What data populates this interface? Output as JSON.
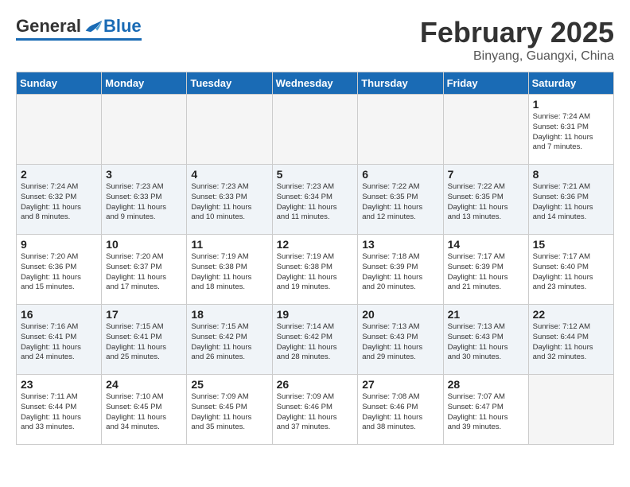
{
  "logo": {
    "general": "General",
    "blue": "Blue"
  },
  "title": "February 2025",
  "location": "Binyang, Guangxi, China",
  "days_of_week": [
    "Sunday",
    "Monday",
    "Tuesday",
    "Wednesday",
    "Thursday",
    "Friday",
    "Saturday"
  ],
  "weeks": [
    [
      {
        "day": "",
        "info": ""
      },
      {
        "day": "",
        "info": ""
      },
      {
        "day": "",
        "info": ""
      },
      {
        "day": "",
        "info": ""
      },
      {
        "day": "",
        "info": ""
      },
      {
        "day": "",
        "info": ""
      },
      {
        "day": "1",
        "info": "Sunrise: 7:24 AM\nSunset: 6:31 PM\nDaylight: 11 hours\nand 7 minutes."
      }
    ],
    [
      {
        "day": "2",
        "info": "Sunrise: 7:24 AM\nSunset: 6:32 PM\nDaylight: 11 hours\nand 8 minutes."
      },
      {
        "day": "3",
        "info": "Sunrise: 7:23 AM\nSunset: 6:33 PM\nDaylight: 11 hours\nand 9 minutes."
      },
      {
        "day": "4",
        "info": "Sunrise: 7:23 AM\nSunset: 6:33 PM\nDaylight: 11 hours\nand 10 minutes."
      },
      {
        "day": "5",
        "info": "Sunrise: 7:23 AM\nSunset: 6:34 PM\nDaylight: 11 hours\nand 11 minutes."
      },
      {
        "day": "6",
        "info": "Sunrise: 7:22 AM\nSunset: 6:35 PM\nDaylight: 11 hours\nand 12 minutes."
      },
      {
        "day": "7",
        "info": "Sunrise: 7:22 AM\nSunset: 6:35 PM\nDaylight: 11 hours\nand 13 minutes."
      },
      {
        "day": "8",
        "info": "Sunrise: 7:21 AM\nSunset: 6:36 PM\nDaylight: 11 hours\nand 14 minutes."
      }
    ],
    [
      {
        "day": "9",
        "info": "Sunrise: 7:20 AM\nSunset: 6:36 PM\nDaylight: 11 hours\nand 15 minutes."
      },
      {
        "day": "10",
        "info": "Sunrise: 7:20 AM\nSunset: 6:37 PM\nDaylight: 11 hours\nand 17 minutes."
      },
      {
        "day": "11",
        "info": "Sunrise: 7:19 AM\nSunset: 6:38 PM\nDaylight: 11 hours\nand 18 minutes."
      },
      {
        "day": "12",
        "info": "Sunrise: 7:19 AM\nSunset: 6:38 PM\nDaylight: 11 hours\nand 19 minutes."
      },
      {
        "day": "13",
        "info": "Sunrise: 7:18 AM\nSunset: 6:39 PM\nDaylight: 11 hours\nand 20 minutes."
      },
      {
        "day": "14",
        "info": "Sunrise: 7:17 AM\nSunset: 6:39 PM\nDaylight: 11 hours\nand 21 minutes."
      },
      {
        "day": "15",
        "info": "Sunrise: 7:17 AM\nSunset: 6:40 PM\nDaylight: 11 hours\nand 23 minutes."
      }
    ],
    [
      {
        "day": "16",
        "info": "Sunrise: 7:16 AM\nSunset: 6:41 PM\nDaylight: 11 hours\nand 24 minutes."
      },
      {
        "day": "17",
        "info": "Sunrise: 7:15 AM\nSunset: 6:41 PM\nDaylight: 11 hours\nand 25 minutes."
      },
      {
        "day": "18",
        "info": "Sunrise: 7:15 AM\nSunset: 6:42 PM\nDaylight: 11 hours\nand 26 minutes."
      },
      {
        "day": "19",
        "info": "Sunrise: 7:14 AM\nSunset: 6:42 PM\nDaylight: 11 hours\nand 28 minutes."
      },
      {
        "day": "20",
        "info": "Sunrise: 7:13 AM\nSunset: 6:43 PM\nDaylight: 11 hours\nand 29 minutes."
      },
      {
        "day": "21",
        "info": "Sunrise: 7:13 AM\nSunset: 6:43 PM\nDaylight: 11 hours\nand 30 minutes."
      },
      {
        "day": "22",
        "info": "Sunrise: 7:12 AM\nSunset: 6:44 PM\nDaylight: 11 hours\nand 32 minutes."
      }
    ],
    [
      {
        "day": "23",
        "info": "Sunrise: 7:11 AM\nSunset: 6:44 PM\nDaylight: 11 hours\nand 33 minutes."
      },
      {
        "day": "24",
        "info": "Sunrise: 7:10 AM\nSunset: 6:45 PM\nDaylight: 11 hours\nand 34 minutes."
      },
      {
        "day": "25",
        "info": "Sunrise: 7:09 AM\nSunset: 6:45 PM\nDaylight: 11 hours\nand 35 minutes."
      },
      {
        "day": "26",
        "info": "Sunrise: 7:09 AM\nSunset: 6:46 PM\nDaylight: 11 hours\nand 37 minutes."
      },
      {
        "day": "27",
        "info": "Sunrise: 7:08 AM\nSunset: 6:46 PM\nDaylight: 11 hours\nand 38 minutes."
      },
      {
        "day": "28",
        "info": "Sunrise: 7:07 AM\nSunset: 6:47 PM\nDaylight: 11 hours\nand 39 minutes."
      },
      {
        "day": "",
        "info": ""
      }
    ]
  ]
}
